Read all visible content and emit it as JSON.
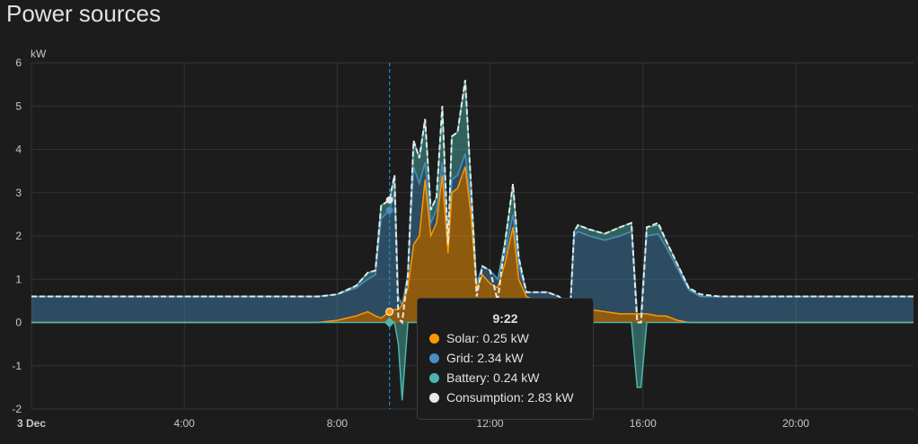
{
  "title": "Power sources",
  "chart_data": {
    "type": "area",
    "title": "Power sources",
    "ylabel": "kW",
    "ylim": [
      -2,
      6
    ],
    "yticks": [
      6,
      5,
      4,
      3,
      2,
      1,
      0,
      -1,
      -2
    ],
    "xlim_hours": [
      0,
      23.08
    ],
    "xticks": [
      {
        "h": 0,
        "label": "3 Dec",
        "bold": true
      },
      {
        "h": 4,
        "label": "4:00"
      },
      {
        "h": 8,
        "label": "8:00"
      },
      {
        "h": 12,
        "label": "12:00"
      },
      {
        "h": 16,
        "label": "16:00"
      },
      {
        "h": 20,
        "label": "20:00"
      }
    ],
    "stacked": true,
    "x": [
      0,
      1,
      2,
      3,
      4,
      5,
      6,
      7,
      7.5,
      8,
      8.5,
      8.8,
      9.0,
      9.15,
      9.37,
      9.5,
      9.6,
      9.7,
      9.85,
      10.0,
      10.15,
      10.3,
      10.45,
      10.6,
      10.75,
      10.9,
      11.0,
      11.15,
      11.35,
      11.5,
      11.65,
      11.8,
      12.0,
      12.2,
      12.4,
      12.6,
      12.75,
      12.95,
      13.2,
      13.5,
      13.8,
      14.1,
      14.2,
      14.3,
      14.6,
      15.0,
      15.4,
      15.7,
      15.85,
      15.95,
      16.1,
      16.4,
      16.6,
      16.9,
      17.2,
      17.5,
      18,
      19,
      20,
      21,
      22,
      23.08
    ],
    "series": [
      {
        "name": "Solar",
        "color": "#ff9800",
        "values": [
          0,
          0,
          0,
          0,
          0,
          0,
          0,
          0,
          0,
          0.05,
          0.15,
          0.25,
          0.15,
          0.1,
          0.25,
          0.3,
          0.3,
          0.4,
          0.8,
          1.8,
          2.0,
          3.3,
          2.0,
          2.3,
          3.4,
          1.6,
          3.0,
          3.1,
          3.6,
          2.5,
          0.8,
          1.1,
          0.9,
          0.8,
          1.4,
          2.2,
          1.0,
          0.6,
          0.5,
          0.4,
          0.3,
          0.3,
          0.3,
          0.3,
          0.3,
          0.25,
          0.2,
          0.2,
          0.2,
          0.2,
          0.2,
          0.15,
          0.15,
          0.05,
          0,
          0,
          0,
          0,
          0,
          0,
          0,
          0
        ]
      },
      {
        "name": "Grid",
        "color": "#488fc2",
        "values": [
          0.6,
          0.6,
          0.6,
          0.6,
          0.6,
          0.6,
          0.6,
          0.6,
          0.6,
          0.6,
          0.65,
          0.75,
          0.95,
          2.3,
          2.34,
          2.7,
          0.3,
          0,
          0.3,
          1.8,
          1.2,
          0.4,
          0.3,
          0.3,
          0.3,
          0.1,
          0.3,
          0.3,
          0.3,
          0.2,
          0.1,
          0.2,
          0.3,
          0.2,
          0.2,
          0.3,
          0.3,
          0.1,
          0.2,
          0.3,
          0.3,
          0.1,
          1.7,
          1.8,
          1.7,
          1.65,
          1.8,
          1.9,
          0,
          0,
          1.8,
          1.9,
          1.6,
          1.2,
          0.75,
          0.6,
          0.6,
          0.6,
          0.6,
          0.6,
          0.6,
          0.6
        ]
      },
      {
        "name": "Battery",
        "color": "#4db6ac",
        "values": [
          0,
          0,
          0,
          0,
          0,
          0,
          0,
          0,
          0,
          0,
          0.05,
          0.15,
          0.1,
          0.3,
          0.24,
          0.4,
          -0.5,
          -1.8,
          0,
          0.6,
          0.6,
          1.0,
          0.3,
          0.3,
          1.3,
          0.1,
          1.0,
          1.0,
          1.7,
          0.5,
          -0.3,
          0,
          0,
          -0.4,
          0.3,
          0.7,
          0.2,
          0,
          0,
          0,
          0,
          0,
          0.1,
          0.15,
          0.15,
          0.15,
          0.2,
          0.2,
          -1.5,
          -1.5,
          0.2,
          0.2,
          0.15,
          0.1,
          0.05,
          0,
          0,
          0,
          0,
          0,
          0,
          0
        ]
      },
      {
        "name": "Consumption",
        "color": "#e8e8e8",
        "dashed": true,
        "values": [
          0.6,
          0.6,
          0.6,
          0.6,
          0.6,
          0.6,
          0.6,
          0.6,
          0.6,
          0.65,
          0.85,
          1.15,
          1.2,
          2.7,
          2.83,
          3.4,
          0.1,
          0,
          1.1,
          4.2,
          3.8,
          4.7,
          2.6,
          2.9,
          5.0,
          1.8,
          4.3,
          4.4,
          5.6,
          3.2,
          0.6,
          1.3,
          1.2,
          0.5,
          1.9,
          3.2,
          1.5,
          0.7,
          0.7,
          0.7,
          0.6,
          0.35,
          2.1,
          2.25,
          2.15,
          2.05,
          2.2,
          2.3,
          0,
          0,
          2.2,
          2.3,
          1.9,
          1.35,
          0.8,
          0.65,
          0.6,
          0.6,
          0.6,
          0.6,
          0.6,
          0.6
        ]
      }
    ],
    "cursor_hour": 9.37
  },
  "tooltip": {
    "time": "9:22",
    "rows": [
      {
        "label": "Solar: 0.25 kW",
        "color": "#ff9800"
      },
      {
        "label": "Grid: 2.34 kW",
        "color": "#488fc2"
      },
      {
        "label": "Battery: 0.24 kW",
        "color": "#4db6ac"
      },
      {
        "label": "Consumption: 2.83 kW",
        "color": "#e8e8e8"
      }
    ]
  }
}
